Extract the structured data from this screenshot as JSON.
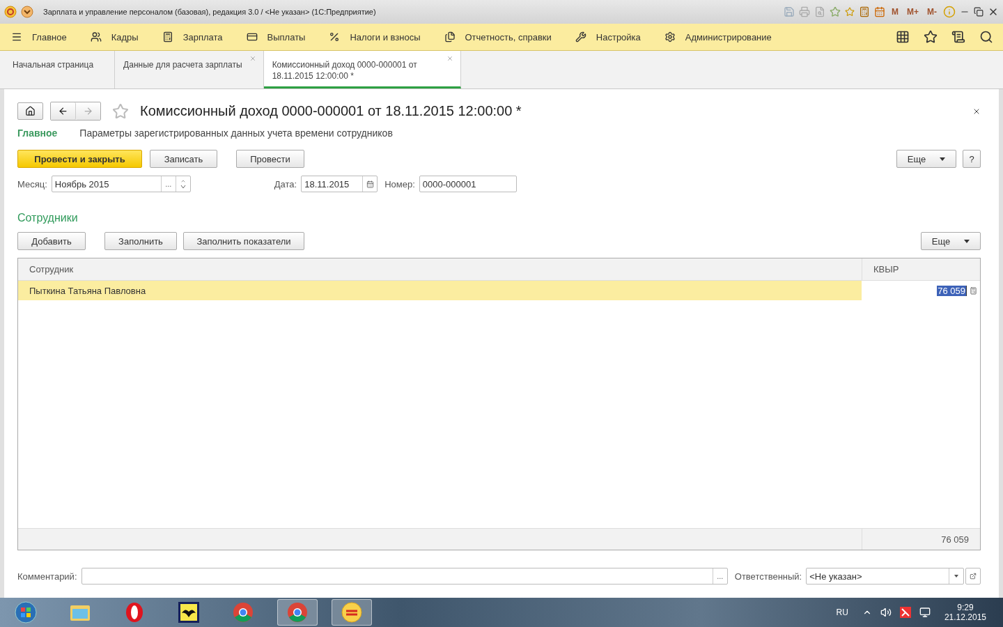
{
  "window": {
    "title": "Зарплата и управление персоналом (базовая), редакция 3.0 / <Не указан>  (1С:Предприятие)"
  },
  "memory_buttons": [
    "M",
    "M+",
    "M-"
  ],
  "sections": [
    {
      "label": "Главное"
    },
    {
      "label": "Кадры"
    },
    {
      "label": "Зарплата"
    },
    {
      "label": "Выплаты"
    },
    {
      "label": "Налоги и взносы"
    },
    {
      "label": "Отчетность, справки"
    },
    {
      "label": "Настройка"
    },
    {
      "label": "Администрирование"
    }
  ],
  "tabs": [
    {
      "label": "Начальная страница",
      "selected": false,
      "closable": false
    },
    {
      "label": "Данные для расчета зарплаты",
      "selected": false,
      "closable": true
    },
    {
      "label": "Комиссионный доход 0000-000001 от 18.11.2015 12:00:00 *",
      "selected": true,
      "closable": true
    }
  ],
  "form": {
    "title": "Комиссионный доход 0000-000001 от 18.11.2015 12:00:00 *",
    "sub_nav": [
      {
        "label": "Главное",
        "selected": true
      },
      {
        "label": "Параметры зарегистрированных данных учета времени сотрудников",
        "selected": false
      }
    ],
    "buttons": [
      {
        "label": "Провести и закрыть",
        "kind": "primary"
      },
      {
        "label": "Записать",
        "kind": "plain"
      },
      {
        "label": "Провести",
        "kind": "plain"
      }
    ],
    "more": "Еще",
    "help": "?",
    "month": {
      "label": "Месяц:",
      "value": "Ноябрь 2015",
      "picker": "..."
    },
    "date": {
      "label": "Дата:",
      "value": "18.11.2015"
    },
    "number": {
      "label": "Номер:",
      "value": "0000-000001"
    },
    "section_title": "Сотрудники",
    "table_buttons": [
      "Добавить",
      "Заполнить",
      "Заполнить показатели"
    ],
    "table_more": "Еще",
    "table": {
      "columns": [
        "Сотрудник",
        "КВЫР"
      ],
      "rows": [
        {
          "employee": "Пыткина Татьяна Павловна",
          "value": "76 059",
          "selected": true,
          "value_selected": true
        }
      ],
      "total": "76 059"
    },
    "comment": {
      "label": "Комментарий:",
      "picker": "..."
    },
    "responsible": {
      "label": "Ответственный:",
      "value": "<Не указан>"
    }
  },
  "taskbar": {
    "language": "RU",
    "time": "9:29",
    "date": "21.12.2015"
  }
}
